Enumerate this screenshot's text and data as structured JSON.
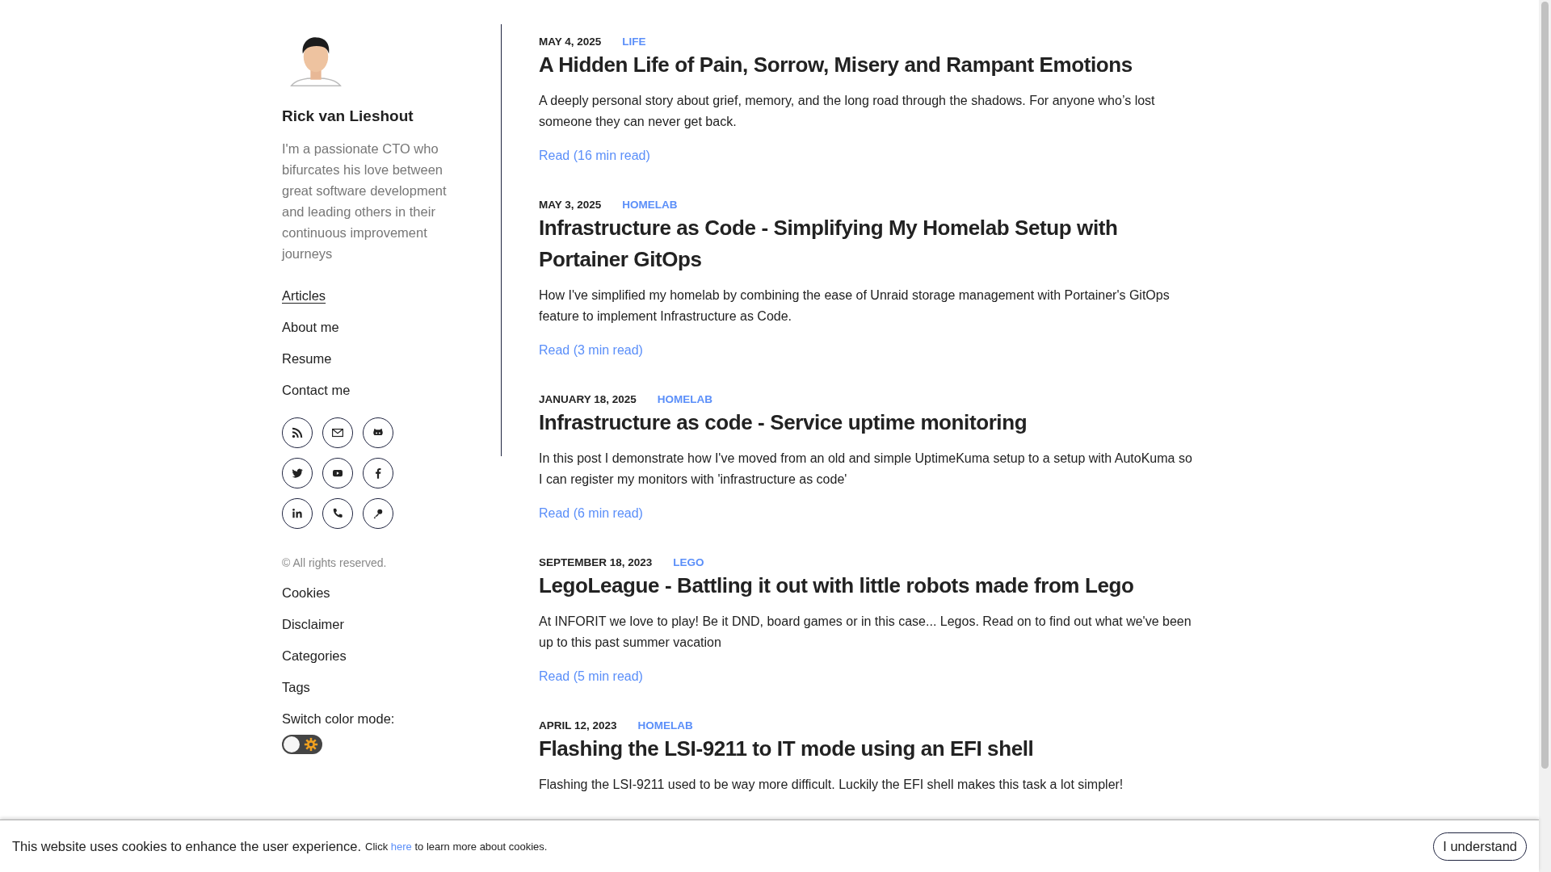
{
  "sidebar": {
    "name": "Rick van Lieshout",
    "bio": "I'm a passionate CTO who bifurcates his love between great software development and leading others in their continuous improvement journeys",
    "nav": [
      {
        "label": "Articles",
        "selected": true
      },
      {
        "label": "About me",
        "selected": false
      },
      {
        "label": "Resume",
        "selected": false
      },
      {
        "label": "Contact me",
        "selected": false
      }
    ],
    "social_icons": [
      {
        "kind": "rss"
      },
      {
        "kind": "mail"
      },
      {
        "kind": "github"
      },
      {
        "kind": "twitter"
      },
      {
        "kind": "youtube"
      },
      {
        "kind": "facebook"
      },
      {
        "kind": "linkedin"
      },
      {
        "kind": "phone"
      },
      {
        "kind": "key"
      }
    ],
    "copyright": "© All rights reserved.",
    "footer_links": [
      "Cookies",
      "Disclaimer",
      "Categories",
      "Tags"
    ],
    "color_mode": {
      "label": "Switch color mode:",
      "dark": false
    }
  },
  "articles": [
    {
      "date": "MAY 4, 2025",
      "category": "LIFE",
      "title": "A Hidden Life of Pain, Sorrow, Misery and Rampant Emotions",
      "excerpt": "A deeply personal story about grief, memory, and the long road through the shadows. For anyone who’s lost someone they can never get back.",
      "read": "Read (16 min read)"
    },
    {
      "date": "MAY 3, 2025",
      "category": "HOMELAB",
      "title": "Infrastructure as Code - Simplifying My Homelab Setup with Portainer GitOps",
      "excerpt": "How I've simplified my homelab by combining the ease of Unraid storage management with Portainer's GitOps feature to implement Infrastructure as Code.",
      "read": "Read (3 min read)"
    },
    {
      "date": "JANUARY 18, 2025",
      "category": "HOMELAB",
      "title": "Infrastructure as code - Service uptime monitoring",
      "excerpt": "In this post I demonstrate how I've moved from an old and simple UptimeKuma setup to a setup with AutoKuma so I can register my monitors with 'infrastructure as code'",
      "read": "Read (6 min read)"
    },
    {
      "date": "SEPTEMBER 18, 2023",
      "category": "LEGO",
      "title": "LegoLeague - Battling it out with little robots made from Lego",
      "excerpt": "At INFORIT we love to play! Be it DND, board games or in this case... Legos. Read on to find out what we've been up to this past summer vacation",
      "read": "Read (5 min read)"
    },
    {
      "date": "APRIL 12, 2023",
      "category": "HOMELAB",
      "title": "Flashing the LSI-9211 to IT mode using an EFI shell",
      "excerpt": "Flashing the LSI-9211 used to be way more difficult. Luckily the EFI shell makes this task a lot simpler!"
    }
  ],
  "cookie_banner": {
    "message": "This website uses cookies to enhance the user experience.",
    "note_before": "Click",
    "link": "here",
    "note_after": "to learn more about cookies.",
    "button": "I understand"
  }
}
